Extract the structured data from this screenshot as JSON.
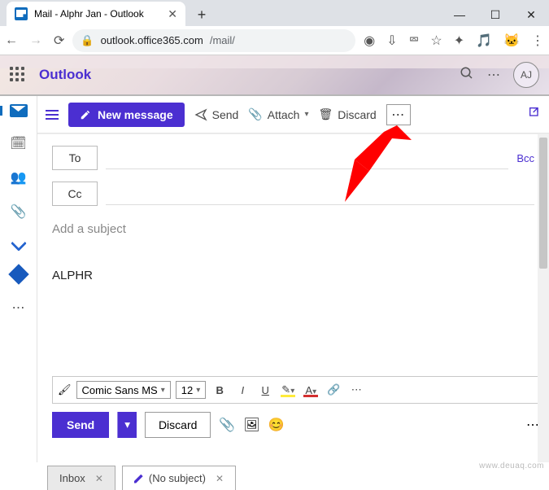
{
  "browser": {
    "tab_title": "Mail - Alphr Jan - Outlook",
    "url_host": "outlook.office365.com",
    "url_path": "/mail/"
  },
  "header": {
    "product": "Outlook",
    "avatar_initials": "AJ"
  },
  "commandbar": {
    "new_message": "New message",
    "send": "Send",
    "attach": "Attach",
    "discard": "Discard"
  },
  "compose": {
    "to_label": "To",
    "cc_label": "Cc",
    "bcc_label": "Bcc",
    "subject_placeholder": "Add a subject",
    "body": "ALPHR"
  },
  "format": {
    "font_name": "Comic Sans MS",
    "font_size": "12"
  },
  "bottom": {
    "send": "Send",
    "discard": "Discard"
  },
  "tabs": {
    "inbox": "Inbox",
    "draft": "(No subject)"
  },
  "watermark": "www.deuaq.com"
}
